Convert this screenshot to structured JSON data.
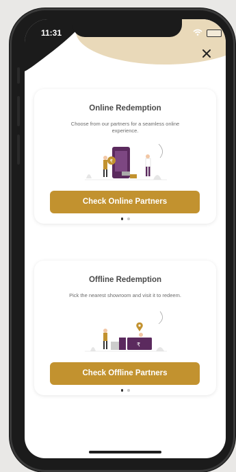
{
  "status_bar": {
    "time": "11:31"
  },
  "close_label": "✕",
  "online_card": {
    "title": "Online Redemption",
    "description": "Choose from our partners for a seamless online experience.",
    "button_label": "Check Online Partners"
  },
  "offline_card": {
    "title": "Offline Redemption",
    "description": "Pick the nearest showroom and visit it to redeem.",
    "button_label": "Check Offline Partners"
  },
  "colors": {
    "accent": "#c2922f",
    "deco_tan": "#e9d9b9",
    "deco_dark": "#1b1b1b",
    "purple": "#5b2a5e"
  },
  "pagination": {
    "active_index": 0,
    "count": 2
  }
}
